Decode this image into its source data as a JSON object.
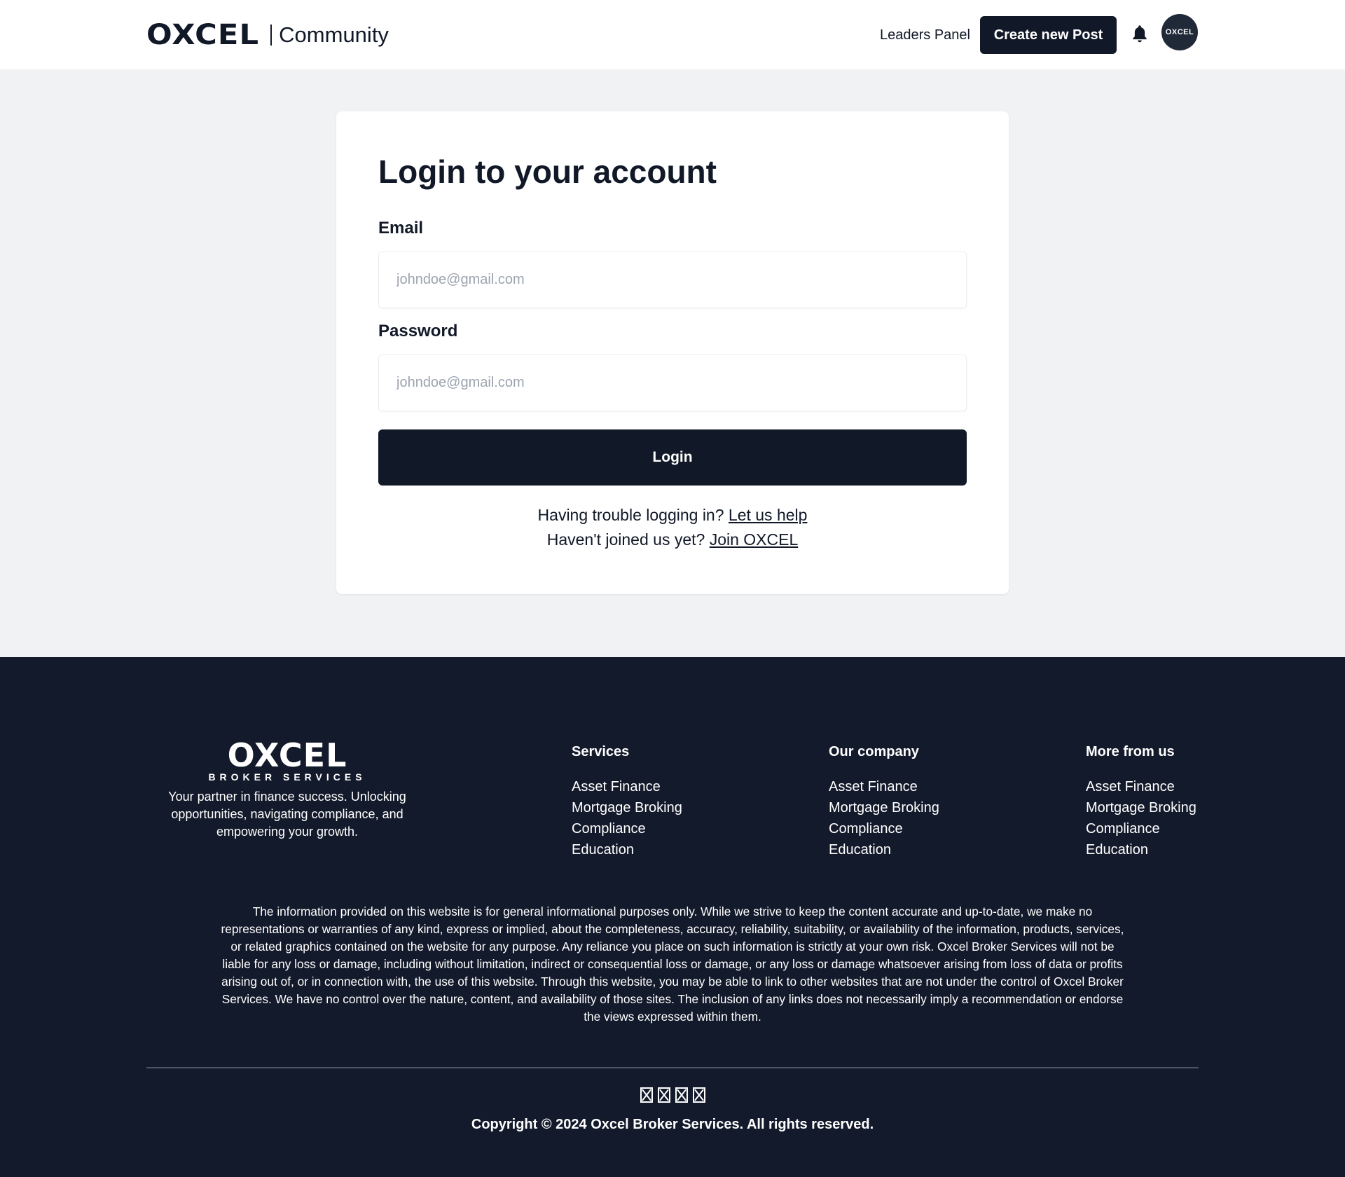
{
  "header": {
    "logo": "OXCEL",
    "community": "Community",
    "leaders_panel": "Leaders Panel",
    "create_post": "Create new Post",
    "avatar_text": "OXCEL"
  },
  "login": {
    "title": "Login to your account",
    "email_label": "Email",
    "email_placeholder": "johndoe@gmail.com",
    "password_label": "Password",
    "password_placeholder": "johndoe@gmail.com",
    "login_button": "Login",
    "trouble_text": "Having trouble logging in?",
    "trouble_link": "Let us help",
    "join_text": "Haven't joined us yet?",
    "join_link": "Join OXCEL"
  },
  "footer": {
    "logo": "OXCEL",
    "logo_sub": "BROKER SERVICES",
    "tagline": "Your partner in finance success. Unlocking opportunities, navigating compliance, and empowering your growth.",
    "columns": [
      {
        "title": "Services",
        "links": [
          "Asset Finance",
          "Mortgage Broking",
          "Compliance",
          "Education"
        ]
      },
      {
        "title": "Our company",
        "links": [
          "Asset Finance",
          "Mortgage Broking",
          "Compliance",
          "Education"
        ]
      },
      {
        "title": "More from us",
        "links": [
          "Asset Finance",
          "Mortgage Broking",
          "Compliance",
          "Education"
        ]
      }
    ],
    "disclaimer": "The information provided on this website is for general informational purposes only. While we strive to keep the content accurate and up-to-date, we make no representations or warranties of any kind, express or implied, about the completeness, accuracy, reliability, suitability, or availability of the information, products, services, or related graphics contained on the website for any purpose. Any reliance you place on such information is strictly at your own risk. Oxcel Broker Services will not be liable for any loss or damage, including without limitation, indirect or consequential loss or damage, or any loss or damage whatsoever arising from loss of data or profits arising out of, or in connection with, the use of this website. Through this website, you may be able to link to other websites that are not under the control of Oxcel Broker Services. We have no control over the nature, content, and availability of those sites. The inclusion of any links does not necessarily imply a recommendation or endorse the views expressed within them.",
    "social_icons": [
      "missing-glyph-icon",
      "missing-glyph-icon",
      "missing-glyph-icon",
      "missing-glyph-icon"
    ],
    "copyright": "Copyright © 2024 Oxcel Broker Services. All rights reserved."
  },
  "colors": {
    "navy": "#111827",
    "footer_bg": "#131a2b",
    "page_bg": "#f1f2f4",
    "card_bg": "#ffffff",
    "placeholder": "#9ca3af"
  }
}
